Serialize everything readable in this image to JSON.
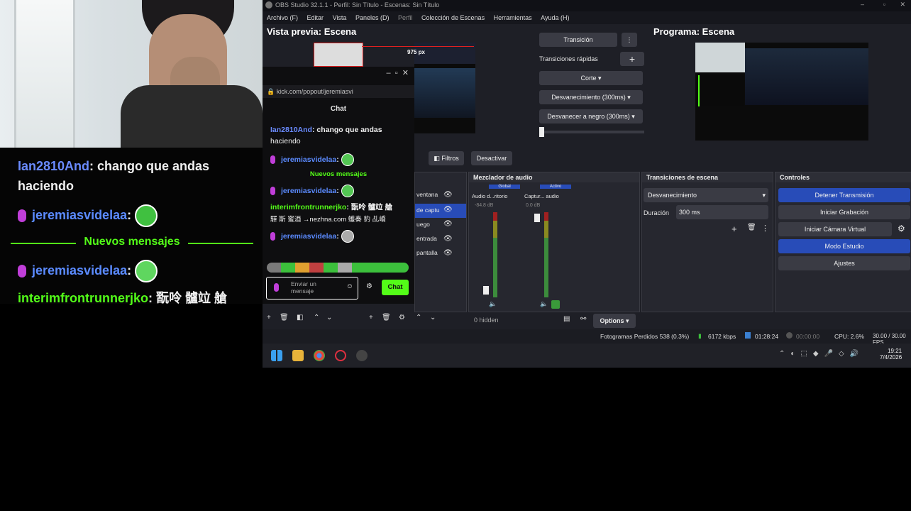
{
  "overlay_chat": {
    "line1_user": "Ian2810And",
    "line1_text": ": chango que andas",
    "line1_text2": "haciendo",
    "line2_user": "jeremiasvidelaa",
    "line2_colon": ":",
    "divider": "Nuevos mensajes",
    "line3_user": "jeremiasvidelaa",
    "line3_colon": ":",
    "line4_user": "interimfrontrunnerjko",
    "line4_text": ": 翫呤 髗竝 艙"
  },
  "obs": {
    "title": "OBS Studio 32.1.1 - Perfil: Sin Título - Escenas: Sin Título",
    "menu": [
      "Archivo (F)",
      "Editar",
      "Vista",
      "Paneles (D)",
      "Perfil",
      "Colección de Escenas",
      "Herramientas",
      "Ayuda (H)"
    ],
    "preview_title": "Vista previa: Escena",
    "program_title": "Programa: Escena",
    "preview_overlay_label": "975 px",
    "transition_button": "Transición",
    "quick_transitions": "Transiciones rápidas",
    "add_symbol": "+",
    "more_symbol": "⋮",
    "quick_items": [
      "Corte",
      "Desvanecimiento (300ms)",
      "Desvanecer a negro (300ms)"
    ],
    "filters_button": "Filtros",
    "deactivate_button": "Desactivar",
    "sources": [
      "ventana",
      "de captu",
      "uego",
      "entrada",
      "pantalla"
    ],
    "audio_mixer": {
      "title": "Mezclador de audio",
      "tab_global": "Global",
      "tab_active": "Activo",
      "ch1": "Audio d...ritorio",
      "ch2": "Captur... audio",
      "db1": "-84.8 dB",
      "db2": "0.0 dB",
      "hidden": "0 hidden",
      "options": "Options",
      "scale": [
        "0",
        "-6",
        "-12",
        "-18",
        "-24",
        "-30",
        "-36",
        "-42",
        "-48",
        "-54",
        "-60"
      ]
    },
    "transitions": {
      "title": "Transiciones de escena",
      "selected": "Desvanecimiento",
      "duration_label": "Duración",
      "duration_value": "300 ms"
    },
    "controls": {
      "title": "Controles",
      "stop_stream": "Detener Transmisión",
      "start_recording": "Iniciar Grabación",
      "start_virtualcam": "Iniciar Cámara Virtual",
      "studio_mode": "Modo Estudio",
      "settings": "Ajustes"
    },
    "status": {
      "dropped": "Fotogramas Perdidos 538 (0.3%)",
      "bitrate": "6172 kbps",
      "stream_time": "01:28:24",
      "rec_time": "00:00:00",
      "cpu": "CPU: 2.6%",
      "fps": "30.00 / 30.00 FPS"
    }
  },
  "chat_popout": {
    "url": "kick.com/popout/jeremiasvi",
    "header": "Chat",
    "l1_user": "Ian2810And",
    "l1_text": ": chango que andas",
    "l1_text2": "haciendo",
    "l2_user": "jeremiasvidelaa",
    "divider": "Nuevos mensajes",
    "l3_user": "jeremiasvidelaa",
    "l4_user": "interimfrontrunnerjko",
    "l4_text": ": 翫呤 髗竝 艙",
    "l4_text2": "驛 斯 蜜酒 →nezhna.com 蠖奏 豹 乩嶠",
    "l5_user": "jeremiasvidelaa",
    "input_placeholder": "Enviar un mensaje",
    "send_button": "Chat"
  },
  "taskbar": {
    "time": "19:21",
    "date": "7/4/2026"
  }
}
